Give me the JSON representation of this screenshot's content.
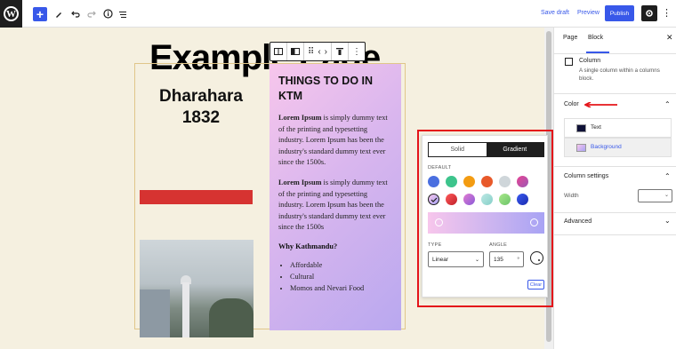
{
  "topbar": {
    "logo_letter": "W",
    "add_icon": "+",
    "save_draft": "Save draft",
    "preview": "Preview",
    "publish": "Publish"
  },
  "canvas": {
    "page_title": "Example Page",
    "left_column": {
      "heading_line1": "Dharahara",
      "heading_line2": "1832"
    },
    "right_column": {
      "heading": "THINGS TO DO IN KTM",
      "paragraphs": [
        {
          "bold": "Lorem Ipsum",
          "text": " is simply dummy text of the printing and typesetting industry. Lorem Ipsum has been the industry's standard dummy text ever since the 1500s."
        },
        {
          "bold": "Lorem Ipsum",
          "text": " is simply dummy text of the printing and typesetting industry. Lorem Ipsum has been the industry's standard dummy text ever since the 1500s"
        }
      ],
      "why_heading": "Why Kathmandu?",
      "list": [
        "Affordable",
        "Cultural",
        "Momos and Nevari Food"
      ]
    }
  },
  "popover": {
    "tabs": [
      "Solid",
      "Gradient"
    ],
    "active_tab": "Gradient",
    "default_label": "DEFAULT",
    "swatches_row1": [
      "#4a6fe0",
      "#3dc48c",
      "#f39c12",
      "#e8592a",
      "#cfd6da",
      "#c64bd6"
    ],
    "swatches_row2": [
      "#b9a8ef",
      "#e0303a",
      "#c77be0",
      "#9fd9d4",
      "#8dd67a",
      "#2b3fd6"
    ],
    "type_label": "TYPE",
    "type_value": "Linear",
    "angle_label": "ANGLE",
    "angle_value": "135",
    "angle_unit": "°",
    "clear": "Clear"
  },
  "sidebar": {
    "tabs": [
      "Page",
      "Block"
    ],
    "active_tab": "Block",
    "close": "✕",
    "block_name": "Column",
    "block_description": "A single column within a columns block.",
    "color_section": "Color",
    "color_items": [
      {
        "label": "Text",
        "chip": "#0f1137"
      },
      {
        "label": "Background",
        "chip": "#d3b4ee"
      }
    ],
    "column_settings": "Column settings",
    "width_label": "Width",
    "advanced": "Advanced"
  },
  "colors": {
    "accent": "#3858e9",
    "highlight": "#e4141a"
  }
}
